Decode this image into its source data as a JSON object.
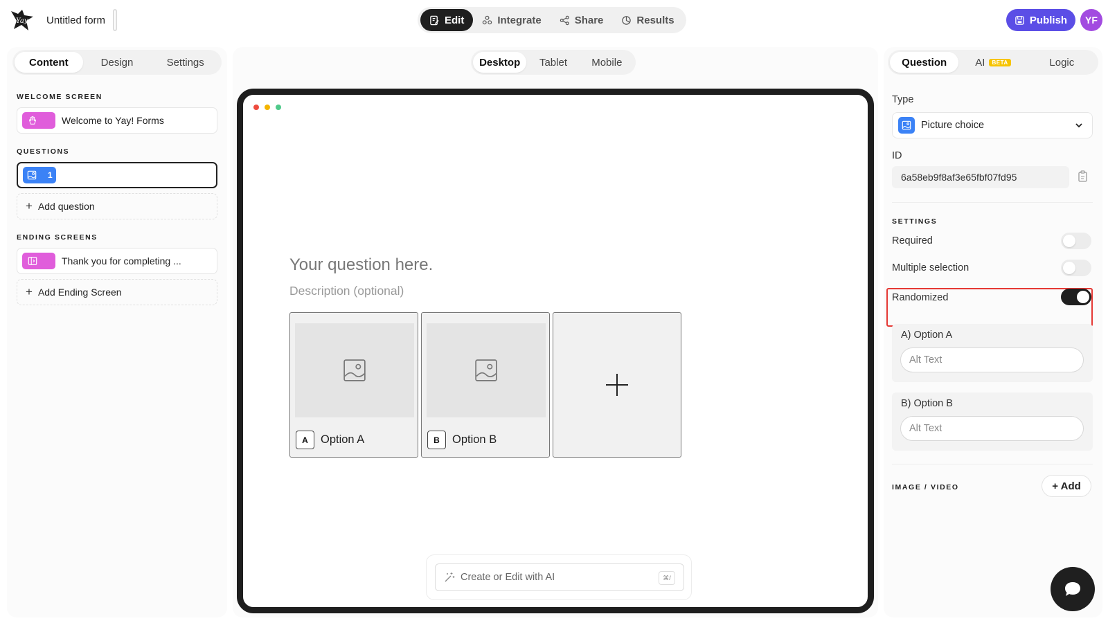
{
  "header": {
    "form_title": "Untitled form",
    "modes": [
      "Edit",
      "Integrate",
      "Share",
      "Results"
    ],
    "active_mode": "Edit",
    "publish_label": "Publish",
    "avatar_initials": "YF",
    "publish_color": "#5b4ee6",
    "avatar_color": "#a24be0"
  },
  "left_panel": {
    "tabs": [
      "Content",
      "Design",
      "Settings"
    ],
    "active_tab": "Content",
    "welcome_label": "WELCOME SCREEN",
    "welcome_item": "Welcome to Yay! Forms",
    "questions_label": "QUESTIONS",
    "question_item_number": "1",
    "add_question": "Add question",
    "ending_label": "ENDING SCREENS",
    "ending_item": "Thank you for completing ...",
    "add_ending": "Add Ending Screen"
  },
  "center_panel": {
    "devices": [
      "Desktop",
      "Tablet",
      "Mobile"
    ],
    "active_device": "Desktop",
    "question_placeholder": "Your question here.",
    "description_placeholder": "Description (optional)",
    "options": [
      {
        "key": "A",
        "label": "Option A"
      },
      {
        "key": "B",
        "label": "Option B"
      }
    ],
    "ai_prompt_placeholder": "Create or Edit with AI",
    "ai_shortcut": "⌘/"
  },
  "right_panel": {
    "tabs": [
      "Question",
      "AI",
      "Logic"
    ],
    "ai_badge": "BETA",
    "active_tab": "Question",
    "type_label": "Type",
    "type_value": "Picture choice",
    "id_label": "ID",
    "id_value": "6a58eb9f8af3e65fbf07fd95",
    "settings_label": "SETTINGS",
    "settings": [
      {
        "label": "Required",
        "on": false
      },
      {
        "label": "Multiple selection",
        "on": false
      },
      {
        "label": "Randomized",
        "on": true
      }
    ],
    "option_alts": [
      {
        "title": "A) Option A",
        "placeholder": "Alt Text"
      },
      {
        "title": "B) Option B",
        "placeholder": "Alt Text"
      }
    ],
    "media_label": "IMAGE / VIDEO",
    "add_label": "+ Add"
  }
}
